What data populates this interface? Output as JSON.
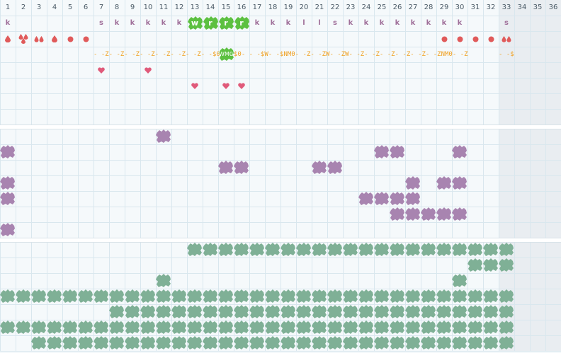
{
  "columns": [
    "1",
    "2",
    "3",
    "4",
    "5",
    "6",
    "7",
    "8",
    "9",
    "10",
    "11",
    "12",
    "13",
    "14",
    "15",
    "16",
    "17",
    "18",
    "19",
    "20",
    "21",
    "22",
    "23",
    "24",
    "25",
    "26",
    "27",
    "28",
    "29",
    "30",
    "31",
    "32",
    "33",
    "34",
    "35",
    "36"
  ],
  "colors": {
    "letter": "#a0709a",
    "green_badge": "#5cc040",
    "red_mark": "#e05a5a",
    "heart": "#e05a7a",
    "orange": "#f0a020",
    "purple_blob": "#a884b0",
    "teal_blob": "#7fb096",
    "grid": "#d9e7ee",
    "shaded_zone": "#e6e9ec"
  },
  "top_panel": {
    "row1_letters": [
      {
        "col": 1,
        "t": "k"
      },
      {
        "col": 7,
        "t": "s"
      },
      {
        "col": 8,
        "t": "k"
      },
      {
        "col": 9,
        "t": "k"
      },
      {
        "col": 10,
        "t": "k"
      },
      {
        "col": 11,
        "t": "k"
      },
      {
        "col": 12,
        "t": "k"
      },
      {
        "col": 13,
        "t": "w",
        "badge": true
      },
      {
        "col": 14,
        "t": "r",
        "badge": true
      },
      {
        "col": 15,
        "t": "r",
        "badge": true
      },
      {
        "col": 16,
        "t": "r",
        "badge": true
      },
      {
        "col": 17,
        "t": "k"
      },
      {
        "col": 18,
        "t": "k"
      },
      {
        "col": 19,
        "t": "k"
      },
      {
        "col": 20,
        "t": "l"
      },
      {
        "col": 21,
        "t": "l"
      },
      {
        "col": 22,
        "t": "s"
      },
      {
        "col": 23,
        "t": "k"
      },
      {
        "col": 24,
        "t": "k"
      },
      {
        "col": 25,
        "t": "k"
      },
      {
        "col": 26,
        "t": "k"
      },
      {
        "col": 27,
        "t": "k"
      },
      {
        "col": 28,
        "t": "k"
      },
      {
        "col": 29,
        "t": "k"
      },
      {
        "col": 30,
        "t": "k"
      },
      {
        "col": 33,
        "t": "s"
      }
    ],
    "row2_marks": [
      {
        "col": 1,
        "t": "drop"
      },
      {
        "col": 2,
        "t": "drops3"
      },
      {
        "col": 3,
        "t": "drops2"
      },
      {
        "col": 4,
        "t": "drop"
      },
      {
        "col": 5,
        "t": "dot"
      },
      {
        "col": 6,
        "t": "dot"
      },
      {
        "col": 29,
        "t": "dot"
      },
      {
        "col": 30,
        "t": "dot"
      },
      {
        "col": 31,
        "t": "dot"
      },
      {
        "col": 32,
        "t": "dot"
      },
      {
        "col": 33,
        "t": "drops2"
      }
    ],
    "row3_sequence": [
      {
        "col": 7,
        "t": "- -Z- -Z- -Z- -Z- -Z- -Z- -Z- -$0"
      },
      {
        "col": 15,
        "t": "WM0",
        "badge": true
      },
      {
        "col": 16,
        "t": "$0- - -$W- -$NM0- -Z- -ZW- -ZW- -Z- -Z- -Z- -Z- -Z- -ZNM0- -Z"
      },
      {
        "col": 33,
        "t": "- -$"
      }
    ],
    "row4_hearts": [
      7,
      10
    ],
    "row5_hearts": [
      13,
      15,
      16
    ]
  },
  "middle_panel": {
    "blobs": [
      {
        "row": 0,
        "cols": [
          11
        ]
      },
      {
        "row": 1,
        "cols": [
          1,
          25,
          26,
          30
        ]
      },
      {
        "row": 2,
        "cols": [
          15,
          16,
          21,
          22
        ]
      },
      {
        "row": 3,
        "cols": [
          1,
          27,
          29,
          30
        ]
      },
      {
        "row": 4,
        "cols": [
          1,
          24,
          25,
          26,
          27
        ]
      },
      {
        "row": 5,
        "cols": [
          26,
          27,
          28,
          29,
          30
        ]
      },
      {
        "row": 6,
        "cols": [
          1
        ]
      }
    ]
  },
  "bottom_panel": {
    "rows": [
      {
        "row": 0,
        "from": 13,
        "to": 33
      },
      {
        "row": 1,
        "from": 31,
        "to": 33
      },
      {
        "row": 2,
        "cols": [
          11,
          30
        ]
      },
      {
        "row": 3,
        "from": 1,
        "to": 33
      },
      {
        "row": 4,
        "from": 8,
        "to": 33
      },
      {
        "row": 5,
        "from": 1,
        "to": 33
      },
      {
        "row": 6,
        "from": 3,
        "to": 33
      }
    ]
  }
}
